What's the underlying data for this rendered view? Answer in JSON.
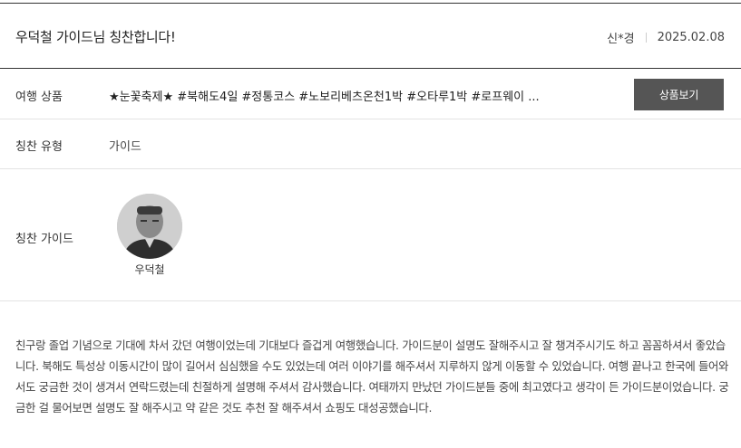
{
  "header": {
    "title": "우덕철 가이드님 칭찬합니다!",
    "author": "신*경",
    "date": "2025.02.08"
  },
  "product": {
    "label": "여행 상품",
    "value": "★눈꽃축제★ #북해도4일 #정통코스 #노보리베츠온천1박 #오타루1박 #로프웨이 ...",
    "button_label": "상품보기"
  },
  "praise_type": {
    "label": "칭찬 유형",
    "value": "가이드"
  },
  "praise_guide": {
    "label": "칭찬 가이드",
    "name": "우덕철"
  },
  "review": {
    "text": "친구랑 졸업 기념으로 기대에 차서 갔던 여행이었는데 기대보다 즐겁게 여행했습니다. 가이드분이 설명도 잘해주시고 잘 챙겨주시기도 하고 꼼꼼하셔서 좋았습니다. 북해도 특성상 이동시간이 많이 길어서 심심했을 수도 있었는데 여러 이야기를 해주셔서 지루하지 않게 이동할 수 있었습니다. 여행 끝나고 한국에 들어와서도 궁금한 것이 생겨서 연락드렸는데 친절하게 설명해 주셔서 감사했습니다. 여태까지 만났던 가이드분들 중에 최고였다고 생각이 든 가이드분이었습니다. 궁금한 걸 물어보면 설명도 잘 해주시고 약 같은 것도 추천 잘 해주셔서 쇼핑도 대성공했습니다."
  }
}
